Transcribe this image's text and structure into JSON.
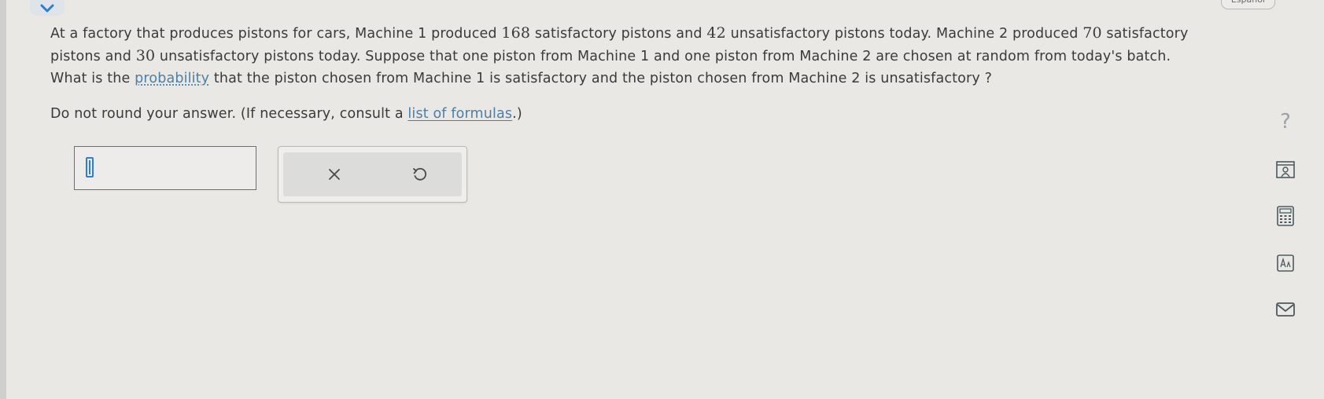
{
  "header": {
    "language_label": "Español"
  },
  "question": {
    "line1_a": "At a factory that produces pistons for cars, Machine 1 produced ",
    "m1_satisfactory": "168",
    "line1_b": " satisfactory pistons and ",
    "m1_unsatisfactory": "42",
    "line1_c": " unsatisfactory pistons today. Machine 2 produced ",
    "m2_satisfactory": "70",
    "line1_d": " satisfactory",
    "line2_a": "pistons and ",
    "m2_unsatisfactory": "30",
    "line2_b": " unsatisfactory pistons today. Suppose that one piston from Machine 1 and one piston from Machine 2 are chosen at random from today's batch.",
    "line3_a": "What is the ",
    "probability_link": "probability",
    "line3_b": " that the piston chosen from Machine 1 is satisfactory and the piston chosen from Machine 2 is unsatisfactory ?"
  },
  "instructions": {
    "text_a": "Do not round your answer. (If necessary, consult a ",
    "formulas_link": "list of formulas",
    "text_b": ".)"
  },
  "answer": {
    "value": ""
  },
  "actions": {
    "clear_glyph": "×",
    "undo_glyph": "↺"
  },
  "tools": {
    "help_glyph": "?"
  },
  "colors": {
    "background": "#e9e8e4",
    "link": "#4d7fa6",
    "cursor": "#2f7fd0"
  }
}
